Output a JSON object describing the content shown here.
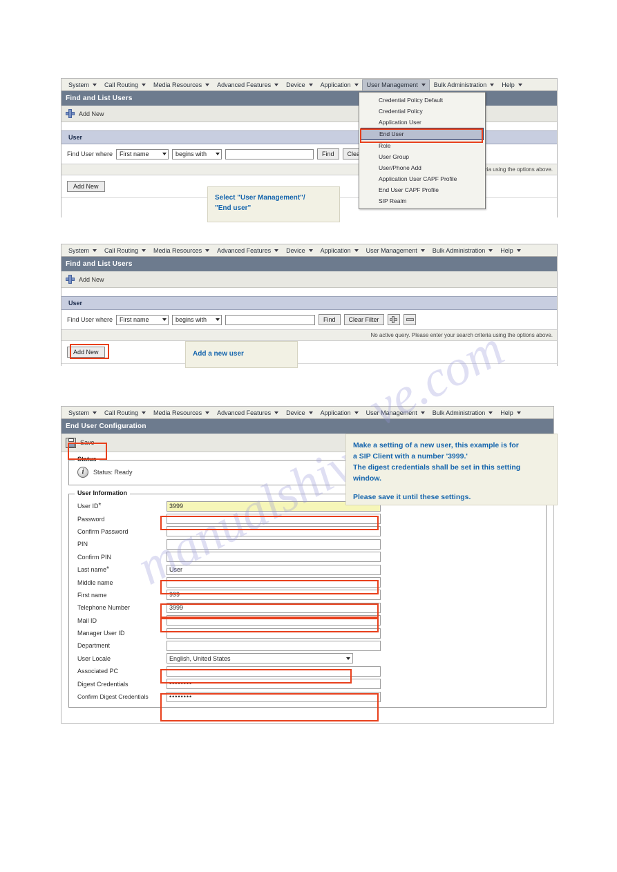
{
  "menu": {
    "items": [
      {
        "label": "System"
      },
      {
        "label": "Call Routing"
      },
      {
        "label": "Media Resources"
      },
      {
        "label": "Advanced Features"
      },
      {
        "label": "Device"
      },
      {
        "label": "Application"
      },
      {
        "label": "User Management"
      },
      {
        "label": "Bulk Administration"
      },
      {
        "label": "Help"
      }
    ],
    "active": "User Management"
  },
  "user_management_dropdown": {
    "items": [
      "Credential Policy Default",
      "Credential Policy",
      "Application User",
      "End User",
      "Role",
      "User Group",
      "User/Phone Add",
      "Application User CAPF Profile",
      "End User CAPF Profile",
      "SIP Realm"
    ],
    "selected": "End User"
  },
  "panel1": {
    "title": "Find and List Users",
    "toolbar": {
      "add_new_label": "Add New",
      "add_new_icon": "plus-icon"
    },
    "section": {
      "header": "User"
    },
    "find": {
      "prefix_label": "Find User where",
      "field_select": "First name",
      "operator_select": "begins with",
      "search_value": "",
      "find_label": "Find",
      "clear_label": "Clear Filter",
      "add_criteria_icon": "plus-icon",
      "remove_criteria_icon": "minus-icon"
    },
    "status_text": "No active query. Please enter your search criteria using the options above.",
    "add_new_button": "Add New"
  },
  "panel2": {
    "title": "Find and List Users",
    "toolbar": {
      "add_new_label": "Add New",
      "add_new_icon": "plus-icon"
    },
    "section": {
      "header": "User"
    },
    "find": {
      "prefix_label": "Find User where",
      "field_select": "First name",
      "operator_select": "begins with",
      "search_value": "",
      "find_label": "Find",
      "clear_label": "Clear Filter",
      "add_criteria_icon": "plus-icon",
      "remove_criteria_icon": "minus-icon"
    },
    "status_text": "No active query. Please enter your search criteria using the options above.",
    "add_new_button": "Add New"
  },
  "panel3": {
    "title": "End User Configuration",
    "toolbar": {
      "save_label": "Save",
      "save_icon": "save-icon"
    },
    "status": {
      "legend": "Status",
      "icon": "info-icon",
      "text": "Status: Ready"
    },
    "user_information": {
      "legend": "User Information",
      "fields": [
        {
          "label": "User ID",
          "required": true,
          "value": "3999",
          "type": "text",
          "style": "required-yellow"
        },
        {
          "label": "Password",
          "required": false,
          "value": "",
          "type": "text",
          "style": "normal"
        },
        {
          "label": "Confirm Password",
          "required": false,
          "value": "",
          "type": "text",
          "style": "normal"
        },
        {
          "label": "PIN",
          "required": false,
          "value": "",
          "type": "text",
          "style": "normal"
        },
        {
          "label": "Confirm PIN",
          "required": false,
          "value": "",
          "type": "text",
          "style": "normal"
        },
        {
          "label": "Last name",
          "required": true,
          "value": "User",
          "type": "text",
          "style": "normal"
        },
        {
          "label": "Middle name",
          "required": false,
          "value": "",
          "type": "text",
          "style": "normal"
        },
        {
          "label": "First name",
          "required": false,
          "value": "999",
          "type": "text",
          "style": "normal"
        },
        {
          "label": "Telephone Number",
          "required": false,
          "value": "3999",
          "type": "text",
          "style": "normal"
        },
        {
          "label": "Mail ID",
          "required": false,
          "value": "",
          "type": "text",
          "style": "normal"
        },
        {
          "label": "Manager User ID",
          "required": false,
          "value": "",
          "type": "text",
          "style": "normal"
        },
        {
          "label": "Department",
          "required": false,
          "value": "",
          "type": "text",
          "style": "normal"
        },
        {
          "label": "User Locale",
          "required": false,
          "value": "English, United States",
          "type": "select",
          "style": "normal"
        },
        {
          "label": "Associated PC",
          "required": false,
          "value": "",
          "type": "text",
          "style": "normal"
        },
        {
          "label": "Digest Credentials",
          "required": false,
          "value": "••••••••",
          "type": "password",
          "style": "normal"
        },
        {
          "label": "Confirm Digest Credentials",
          "required": false,
          "value": "••••••••",
          "type": "password",
          "style": "normal"
        }
      ]
    }
  },
  "callouts": {
    "one": "Select \"User Management\"/\n\"End user\"",
    "two": "Add a new user",
    "three": "Make a setting of a new user, this example is for a SIP Client with a number '3999.'\nThe digest credentials shall be set in this setting window.\n\nPlease save it until these settings."
  },
  "watermark": {
    "text_left": "manualshive",
    "text_right": "ve.com"
  },
  "colors": {
    "titlebar": "#6d7b8e",
    "section_bar": "#c8cee0",
    "highlight_red": "#e8401c",
    "callout_text": "#1565ad",
    "required_field": "#f6f6b8",
    "menu_active": "#bcc2cc"
  }
}
